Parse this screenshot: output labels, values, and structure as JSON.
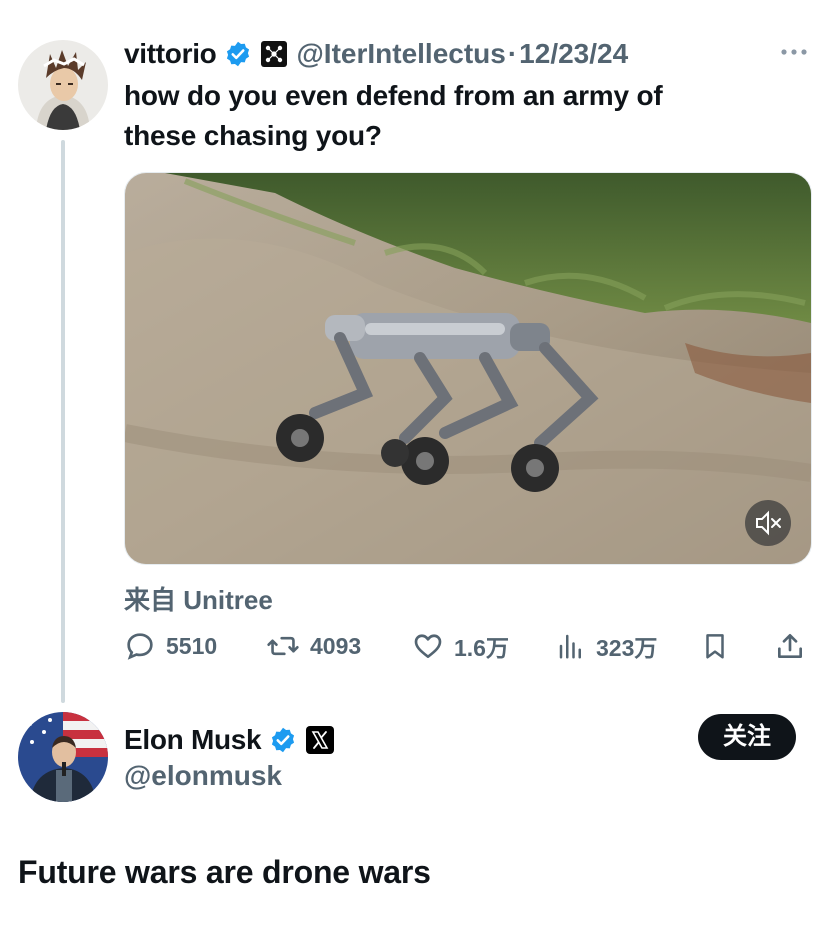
{
  "original_tweet": {
    "display_name": "vittorio",
    "handle": "@IterIntellectus",
    "separator": "·",
    "date": "12/23/24",
    "text_line1": "how do you even defend from an army of",
    "text_line2": "these chasing you?",
    "more_icon": "more-horizontal-icon",
    "source_label": "来自 Unitree",
    "actions": {
      "replies": "5510",
      "reposts": "4093",
      "likes": "1.6万",
      "views": "323万"
    }
  },
  "reply_tweet": {
    "display_name": "Elon Musk",
    "handle": "@elonmusk",
    "follow_label": "关注",
    "text": "Future wars are drone wars"
  },
  "colors": {
    "verified_blue": "#1d9bf0",
    "secondary_text": "#536471",
    "primary_text": "#0f1419",
    "thread_line": "#cfd9de"
  }
}
